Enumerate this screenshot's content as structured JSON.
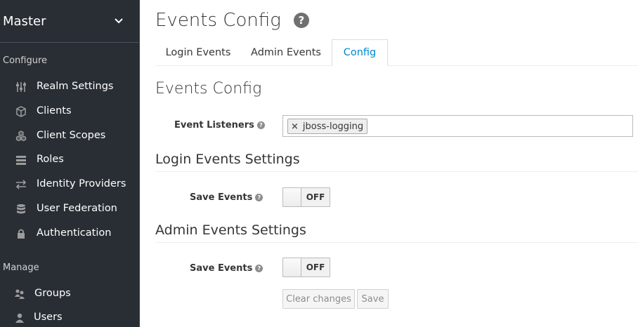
{
  "sidebar": {
    "realm": "Master",
    "configure_label": "Configure",
    "manage_label": "Manage",
    "configure_items": [
      {
        "label": "Realm Settings",
        "icon": "sliders-icon"
      },
      {
        "label": "Clients",
        "icon": "cube-icon"
      },
      {
        "label": "Client Scopes",
        "icon": "cubes-icon"
      },
      {
        "label": "Roles",
        "icon": "list-icon"
      },
      {
        "label": "Identity Providers",
        "icon": "exchange-icon"
      },
      {
        "label": "User Federation",
        "icon": "database-icon"
      },
      {
        "label": "Authentication",
        "icon": "lock-icon"
      }
    ],
    "manage_items": [
      {
        "label": "Groups",
        "icon": "users-icon"
      },
      {
        "label": "Users",
        "icon": "user-icon"
      }
    ]
  },
  "main": {
    "title": "Events Config",
    "tabs": [
      {
        "label": "Login Events",
        "active": false
      },
      {
        "label": "Admin Events",
        "active": false
      },
      {
        "label": "Config",
        "active": true
      }
    ],
    "section_title": "Events Config",
    "event_listeners_label": "Event Listeners",
    "event_listeners": [
      "jboss-logging"
    ],
    "login_settings_title": "Login Events Settings",
    "login_save_events_label": "Save Events",
    "login_save_events_state": "OFF",
    "admin_settings_title": "Admin Events Settings",
    "admin_save_events_label": "Save Events",
    "admin_save_events_state": "OFF",
    "clear_changes_label": "Clear changes",
    "save_label": "Save"
  },
  "colors": {
    "sidebar_bg": "#292e34",
    "active_tab": "#0088ce",
    "text": "#363636"
  }
}
